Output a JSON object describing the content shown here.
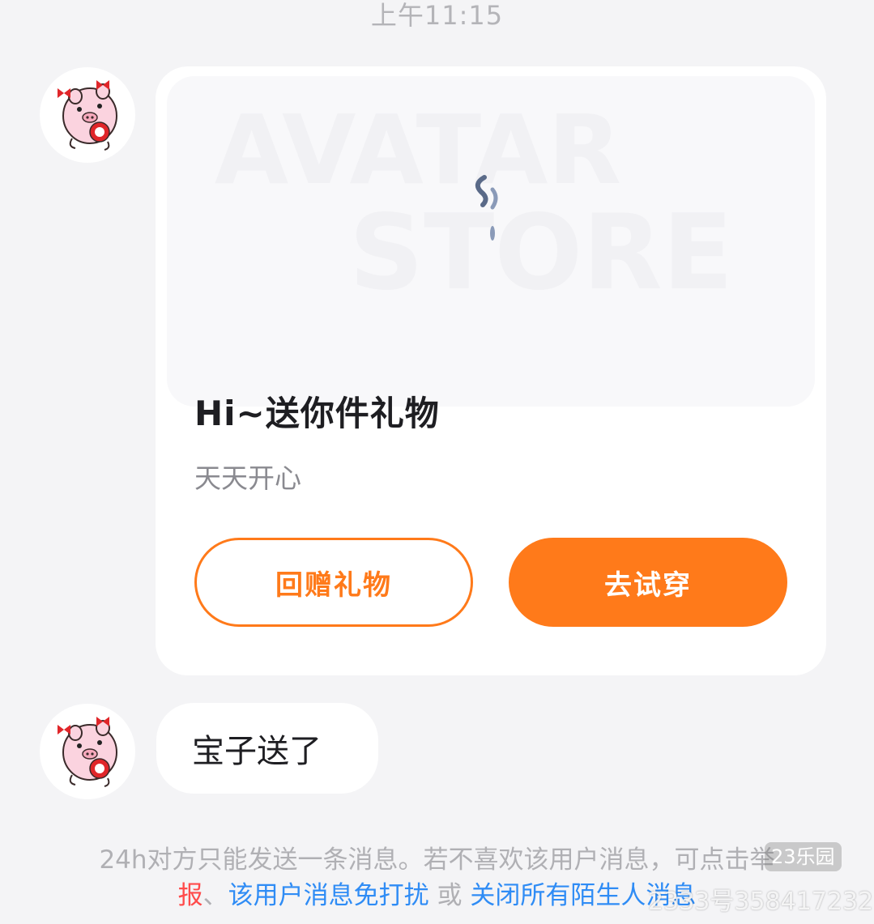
{
  "chat": {
    "timestamp": "上午11:15",
    "gift_card": {
      "banner_text_1": "AVATAR",
      "banner_text_2": "STORE",
      "title": "Hi~送你件礼物",
      "subtitle": "天天开心",
      "return_gift_label": "回赠礼物",
      "try_on_label": "去试穿"
    },
    "message": {
      "text": "宝子送了"
    },
    "notice": {
      "line1": "24h对方只能发送一条消息。若不喜欢该用户消息，可点击举",
      "report_fragment": "报",
      "separator": "、",
      "mute_user_link": "该用户消息免打扰",
      "or_text": " 或 ",
      "close_all_link": "关闭所有陌生人消息"
    },
    "watermark": {
      "badge": "23乐园",
      "text": "2333号358417232"
    }
  },
  "colors": {
    "accent": "#ff7a1a",
    "link": "#2f8cf5",
    "report": "#ff4b4b",
    "background": "#f4f4f6"
  }
}
